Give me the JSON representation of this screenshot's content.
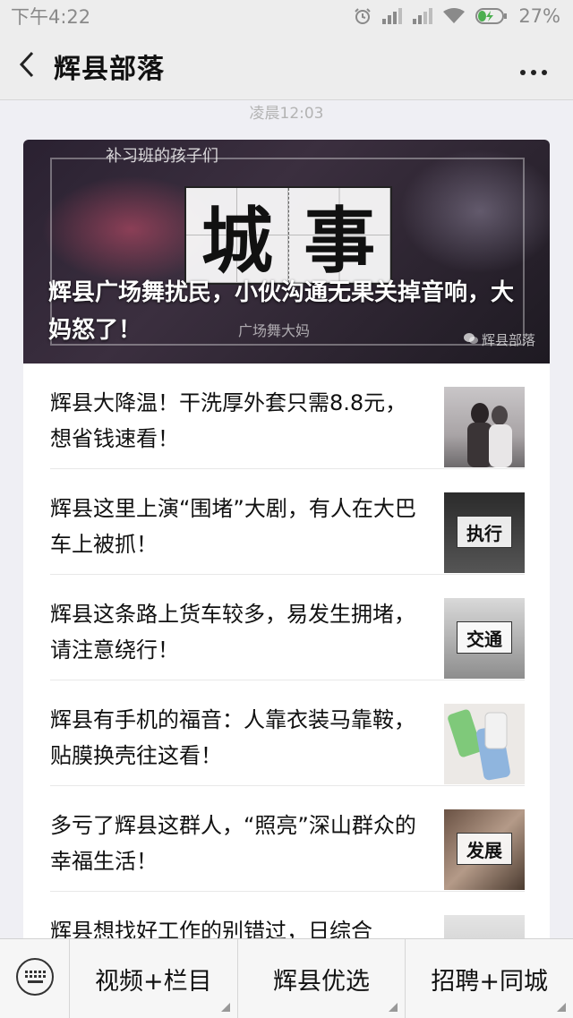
{
  "status_bar": {
    "time": "下午4:22",
    "battery": "27%"
  },
  "nav": {
    "title": "辉县部落"
  },
  "timestamp": "凌晨12:03",
  "cover": {
    "sign_top": "补习班的孩子们",
    "sign_bottom": "广场舞大妈",
    "badge_chars": [
      "城",
      "事"
    ],
    "title": "辉县广场舞扰民，小伙沟通无果关掉音响，大妈怒了！",
    "watermark": "辉县部落"
  },
  "articles": [
    {
      "title": "辉县大降温！干洗厚外套只需8.8元，想省钱速看！",
      "thumb_label": ""
    },
    {
      "title": "辉县这里上演“围堵”大剧，有人在大巴车上被抓！",
      "thumb_label": "执行"
    },
    {
      "title": "辉县这条路上货车较多，易发生拥堵，请注意绕行！",
      "thumb_label": "交通"
    },
    {
      "title": "辉县有手机的福音：人靠衣装马靠鞍，贴膜换壳往这看！",
      "thumb_label": ""
    },
    {
      "title": "多亏了辉县这群人，“照亮”深山群众的幸福生活！",
      "thumb_label": "发展"
    },
    {
      "title": "辉县想找好工作的别错过，日综合",
      "thumb_label": ""
    }
  ],
  "bottom_menu": {
    "items": [
      "视频+栏目",
      "辉县优选",
      "招聘+同城"
    ]
  },
  "icons": {
    "back": "back-arrow-icon",
    "more": "more-dots-icon",
    "keyboard": "keyboard-icon",
    "alarm": "alarm-icon",
    "signal": "signal-icon",
    "wifi": "wifi-icon",
    "battery": "battery-charging-icon"
  },
  "colors": {
    "nav_bg": "#ededed",
    "page_bg": "#efeff4",
    "card_bg": "#ffffff",
    "battery_accent": "#4caf50"
  }
}
